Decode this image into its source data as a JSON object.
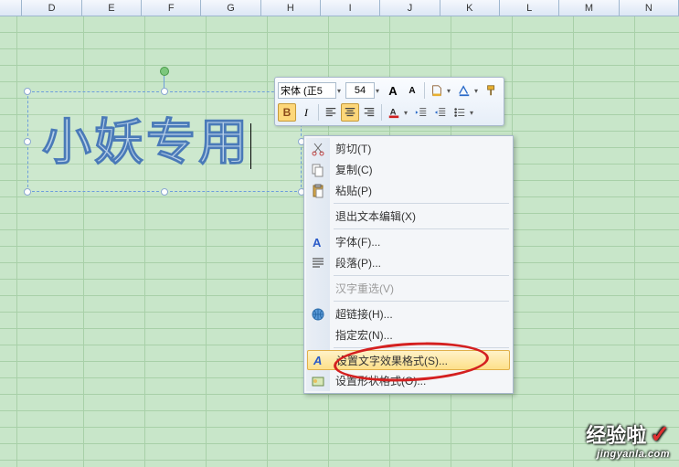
{
  "columns": [
    "D",
    "E",
    "F",
    "G",
    "H",
    "I",
    "J",
    "K",
    "L",
    "M",
    "N"
  ],
  "wordart_text": "小妖专用",
  "mini_toolbar": {
    "font_name": "宋体 (正5",
    "font_size": "54",
    "grow": "A",
    "shrink": "A",
    "bold": "B",
    "italic": "I"
  },
  "menu": {
    "cut": "剪切(T)",
    "copy": "复制(C)",
    "paste": "粘贴(P)",
    "exit_edit": "退出文本编辑(X)",
    "font": "字体(F)...",
    "paragraph": "段落(P)...",
    "reconvert": "汉字重选(V)",
    "hyperlink": "超链接(H)...",
    "assign_macro": "指定宏(N)...",
    "text_effects": "设置文字效果格式(S)...",
    "shape_format": "设置形状格式(O)..."
  },
  "watermark": {
    "title": "经验啦",
    "sub": "jingyanla.com"
  }
}
